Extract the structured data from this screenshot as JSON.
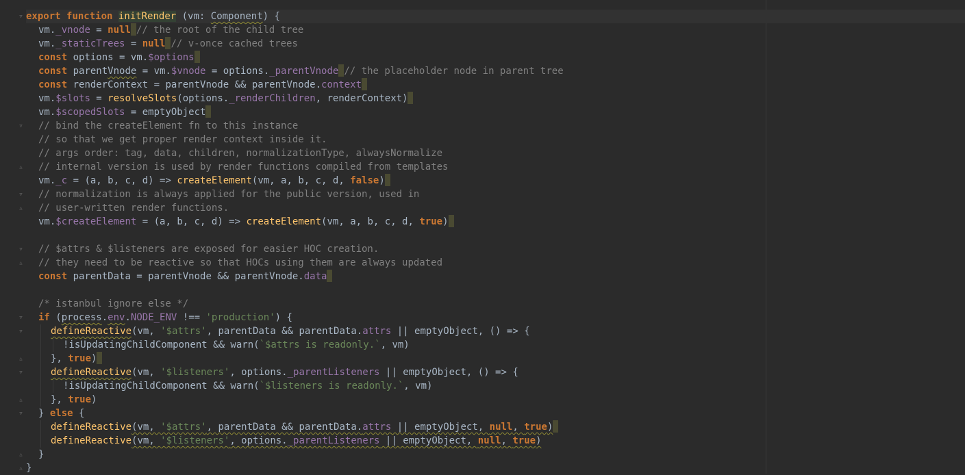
{
  "editor": {
    "language": "javascript",
    "colors": {
      "background": "#2b2b2b",
      "keyword": "#cc7832",
      "function": "#ffc66d",
      "property": "#9876aa",
      "string": "#6a8759",
      "comment": "#808080",
      "text": "#a9b7c6"
    },
    "lines": [
      {
        "fold": "open",
        "indent": 0,
        "current": true,
        "tokens": [
          [
            "kw",
            "export"
          ],
          [
            "t",
            " "
          ],
          [
            "kw",
            "function"
          ],
          [
            "t",
            " "
          ],
          [
            "fn-decl",
            "initRender"
          ],
          [
            "t",
            " (vm: "
          ],
          [
            "type squig",
            "Component"
          ],
          [
            "t",
            ") {"
          ]
        ]
      },
      {
        "indent": 1,
        "tokens": [
          [
            "t",
            "vm."
          ],
          [
            "prop",
            "_vnode"
          ],
          [
            "t",
            " = "
          ],
          [
            "kw",
            "null"
          ],
          [
            "caret",
            ""
          ],
          [
            "cm",
            "// the root of the child tree"
          ]
        ]
      },
      {
        "indent": 1,
        "tokens": [
          [
            "t",
            "vm."
          ],
          [
            "prop",
            "_staticTrees"
          ],
          [
            "t",
            " = "
          ],
          [
            "kw",
            "null"
          ],
          [
            "caret",
            ""
          ],
          [
            "cm",
            "// v-once cached trees"
          ]
        ]
      },
      {
        "indent": 1,
        "tokens": [
          [
            "kw",
            "const"
          ],
          [
            "t",
            " options = vm."
          ],
          [
            "prop",
            "$options"
          ],
          [
            "caret",
            ""
          ]
        ]
      },
      {
        "indent": 1,
        "tokens": [
          [
            "kw",
            "const"
          ],
          [
            "t",
            " parent"
          ],
          [
            "t squig",
            "Vnode"
          ],
          [
            "t",
            " = vm."
          ],
          [
            "prop",
            "$vnode"
          ],
          [
            "t",
            " = options."
          ],
          [
            "prop",
            "_parentVnode"
          ],
          [
            "caret",
            ""
          ],
          [
            "cm",
            "// the placeholder node in parent tree"
          ]
        ]
      },
      {
        "indent": 1,
        "tokens": [
          [
            "kw",
            "const"
          ],
          [
            "t",
            " renderContext = parentVnode && parentVnode."
          ],
          [
            "prop",
            "context"
          ],
          [
            "caret",
            ""
          ]
        ]
      },
      {
        "indent": 1,
        "tokens": [
          [
            "t",
            "vm."
          ],
          [
            "prop",
            "$slots"
          ],
          [
            "t",
            " = "
          ],
          [
            "fn",
            "resolveSlots"
          ],
          [
            "t",
            "(options."
          ],
          [
            "prop",
            "_renderChildren"
          ],
          [
            "t",
            ", renderContext)"
          ],
          [
            "caret",
            ""
          ]
        ]
      },
      {
        "indent": 1,
        "tokens": [
          [
            "t",
            "vm."
          ],
          [
            "prop",
            "$scopedSlots"
          ],
          [
            "t",
            " = emptyObject"
          ],
          [
            "caret",
            ""
          ]
        ]
      },
      {
        "fold": "open",
        "indent": 1,
        "tokens": [
          [
            "cm",
            "// bind the createElement fn to this instance"
          ]
        ]
      },
      {
        "indent": 1,
        "tokens": [
          [
            "cm",
            "// so that we get proper render context inside it."
          ]
        ]
      },
      {
        "indent": 1,
        "tokens": [
          [
            "cm",
            "// args order: tag, data, children, normalizationType, alwaysNormalize"
          ]
        ]
      },
      {
        "fold": "close",
        "indent": 1,
        "tokens": [
          [
            "cm",
            "// internal version is used by render functions compiled from templates"
          ]
        ]
      },
      {
        "indent": 1,
        "tokens": [
          [
            "t",
            "vm."
          ],
          [
            "prop",
            "_c"
          ],
          [
            "t",
            " = (a, b, c, d) => "
          ],
          [
            "fn",
            "createElement"
          ],
          [
            "t",
            "(vm, a, b, c, d, "
          ],
          [
            "kw",
            "false"
          ],
          [
            "t",
            ")"
          ],
          [
            "caret",
            ""
          ]
        ]
      },
      {
        "fold": "open",
        "indent": 1,
        "tokens": [
          [
            "cm",
            "// normalization is always applied for the public version, used in"
          ]
        ]
      },
      {
        "fold": "close",
        "indent": 1,
        "tokens": [
          [
            "cm",
            "// user-written render functions."
          ]
        ]
      },
      {
        "indent": 1,
        "tokens": [
          [
            "t",
            "vm."
          ],
          [
            "prop",
            "$createElement"
          ],
          [
            "t",
            " = (a, b, c, d) => "
          ],
          [
            "fn",
            "createElement"
          ],
          [
            "t",
            "(vm, a, b, c, d, "
          ],
          [
            "kw",
            "true"
          ],
          [
            "t",
            ")"
          ],
          [
            "caret",
            ""
          ]
        ]
      },
      {
        "indent": 1,
        "tokens": []
      },
      {
        "fold": "open",
        "indent": 1,
        "tokens": [
          [
            "cm",
            "// $attrs & $listeners are exposed for easier HOC creation."
          ]
        ]
      },
      {
        "fold": "close",
        "indent": 1,
        "tokens": [
          [
            "cm",
            "// they need to be reactive so that HOCs using them are always updated"
          ]
        ]
      },
      {
        "indent": 1,
        "tokens": [
          [
            "kw",
            "const"
          ],
          [
            "t",
            " parentData = parentVnode && parentVnode."
          ],
          [
            "prop",
            "data"
          ],
          [
            "caret",
            ""
          ]
        ]
      },
      {
        "indent": 1,
        "tokens": []
      },
      {
        "indent": 1,
        "tokens": [
          [
            "cm",
            "/* istanbul ignore else */"
          ]
        ]
      },
      {
        "fold": "open",
        "indent": 1,
        "tokens": [
          [
            "kw",
            "if"
          ],
          [
            "t",
            " ("
          ],
          [
            "t squig",
            "process"
          ],
          [
            "t",
            "."
          ],
          [
            "prop squig",
            "env"
          ],
          [
            "t",
            "."
          ],
          [
            "prop",
            "NODE_ENV"
          ],
          [
            "t",
            " !== "
          ],
          [
            "str",
            "'production'"
          ],
          [
            "t",
            ") {"
          ]
        ]
      },
      {
        "fold": "open",
        "indent": 2,
        "tokens": [
          [
            "fn squig",
            "defineReactive"
          ],
          [
            "t",
            "(vm, "
          ],
          [
            "str",
            "'$attrs'"
          ],
          [
            "t",
            ", parentData && parentData."
          ],
          [
            "prop",
            "attrs"
          ],
          [
            "t",
            " || emptyObject, () => {"
          ]
        ]
      },
      {
        "indent": 3,
        "tokens": [
          [
            "t",
            "!isUpdatingChildComponent && warn("
          ],
          [
            "str",
            "`$attrs is readonly.`"
          ],
          [
            "t",
            ", vm)"
          ]
        ]
      },
      {
        "fold": "close",
        "indent": 2,
        "tokens": [
          [
            "t",
            "}, "
          ],
          [
            "kw",
            "true"
          ],
          [
            "t",
            ")"
          ],
          [
            "caret",
            ""
          ]
        ]
      },
      {
        "fold": "open",
        "indent": 2,
        "tokens": [
          [
            "fn squig",
            "defineReactive"
          ],
          [
            "t",
            "(vm, "
          ],
          [
            "str",
            "'$listeners'"
          ],
          [
            "t",
            ", options."
          ],
          [
            "prop",
            "_parentListeners"
          ],
          [
            "t",
            " || emptyObject, () => {"
          ]
        ]
      },
      {
        "indent": 3,
        "tokens": [
          [
            "t",
            "!isUpdatingChildComponent && warn("
          ],
          [
            "str",
            "`$listeners is readonly.`"
          ],
          [
            "t",
            ", vm)"
          ]
        ]
      },
      {
        "fold": "close",
        "indent": 2,
        "tokens": [
          [
            "t",
            "}, "
          ],
          [
            "kw",
            "true"
          ],
          [
            "t",
            ")"
          ]
        ]
      },
      {
        "fold": "open",
        "indent": 1,
        "tokens": [
          [
            "t",
            "} "
          ],
          [
            "kw",
            "else"
          ],
          [
            "t",
            " {"
          ]
        ]
      },
      {
        "indent": 2,
        "tokens": [
          [
            "fn",
            "defineReactive"
          ],
          [
            "t squig",
            "(vm, "
          ],
          [
            "str squig",
            "'$attrs'"
          ],
          [
            "t squig",
            ", parentData && parentData."
          ],
          [
            "prop squig",
            "attrs"
          ],
          [
            "t squig",
            " || emptyObject, "
          ],
          [
            "kw squig",
            "null"
          ],
          [
            "t squig",
            ", "
          ],
          [
            "kw squig",
            "true"
          ],
          [
            "t squig",
            ")"
          ],
          [
            "caret",
            ""
          ]
        ]
      },
      {
        "indent": 2,
        "tokens": [
          [
            "fn",
            "defineReactive"
          ],
          [
            "t squig",
            "(vm, "
          ],
          [
            "str squig",
            "'$listeners'"
          ],
          [
            "t squig",
            ", options."
          ],
          [
            "prop squig",
            "_parentListeners"
          ],
          [
            "t squig",
            " || emptyObject, "
          ],
          [
            "kw squig",
            "null"
          ],
          [
            "t squig",
            ", "
          ],
          [
            "kw squig",
            "true"
          ],
          [
            "t squig",
            ")"
          ]
        ]
      },
      {
        "fold": "close",
        "indent": 1,
        "tokens": [
          [
            "t",
            "}"
          ]
        ]
      },
      {
        "fold": "close",
        "indent": 0,
        "tokens": [
          [
            "t",
            "}"
          ]
        ]
      }
    ]
  }
}
